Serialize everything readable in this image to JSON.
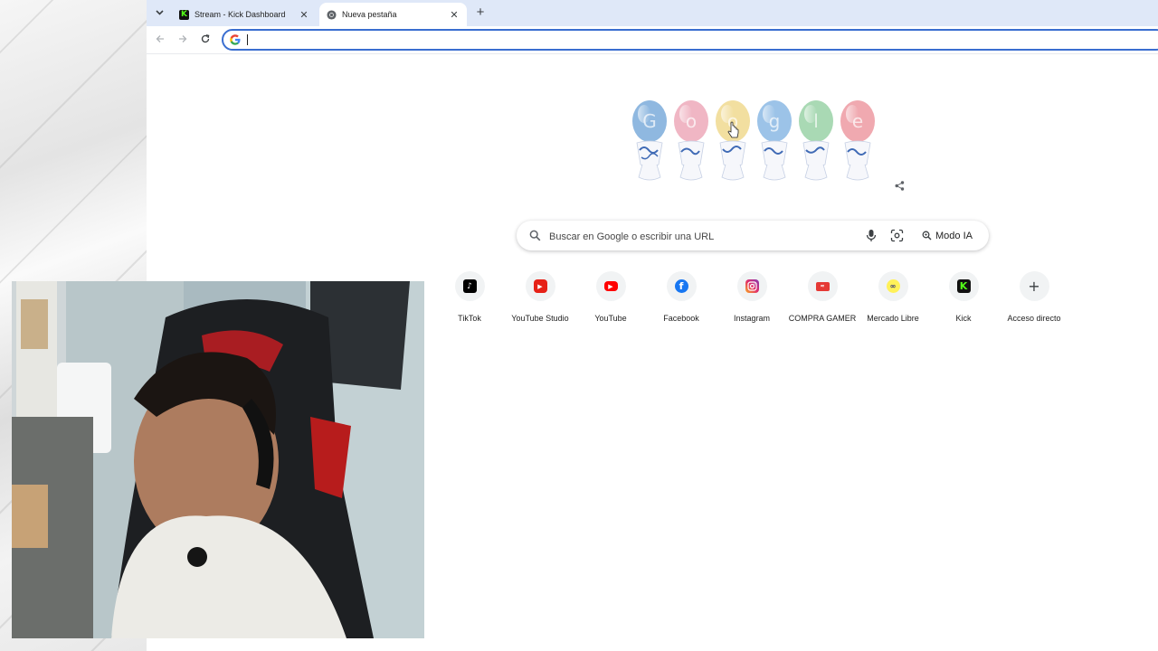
{
  "tabs": [
    {
      "title": "Stream - Kick Dashboard",
      "favicon": "kick-icon",
      "active": false
    },
    {
      "title": "Nueva pestaña",
      "favicon": "chrome-icon",
      "active": true
    }
  ],
  "omnibox": {
    "value": ""
  },
  "search": {
    "placeholder": "Buscar en Google o escribir una URL",
    "ai_mode_label": "Modo IA"
  },
  "shortcuts": [
    {
      "label": "TikTok",
      "icon": "tiktok-icon"
    },
    {
      "label": "YouTube Studio",
      "icon": "youtube-studio-icon"
    },
    {
      "label": "YouTube",
      "icon": "youtube-icon"
    },
    {
      "label": "Facebook",
      "icon": "facebook-icon"
    },
    {
      "label": "Instagram",
      "icon": "instagram-icon"
    },
    {
      "label": "COMPRA GAMER",
      "icon": "compra-gamer-icon"
    },
    {
      "label": "Mercado Libre",
      "icon": "mercado-libre-icon"
    },
    {
      "label": "Kick",
      "icon": "kick-icon"
    },
    {
      "label": "Acceso directo",
      "icon": "plus-icon"
    }
  ],
  "doodle": {
    "letters": [
      "G",
      "o",
      "o",
      "g",
      "l",
      "e"
    ],
    "colors": [
      "#8fb8e0",
      "#f0b6c4",
      "#f2dfa0",
      "#9cc3e8",
      "#a9d9b4",
      "#f0a9b0"
    ]
  }
}
